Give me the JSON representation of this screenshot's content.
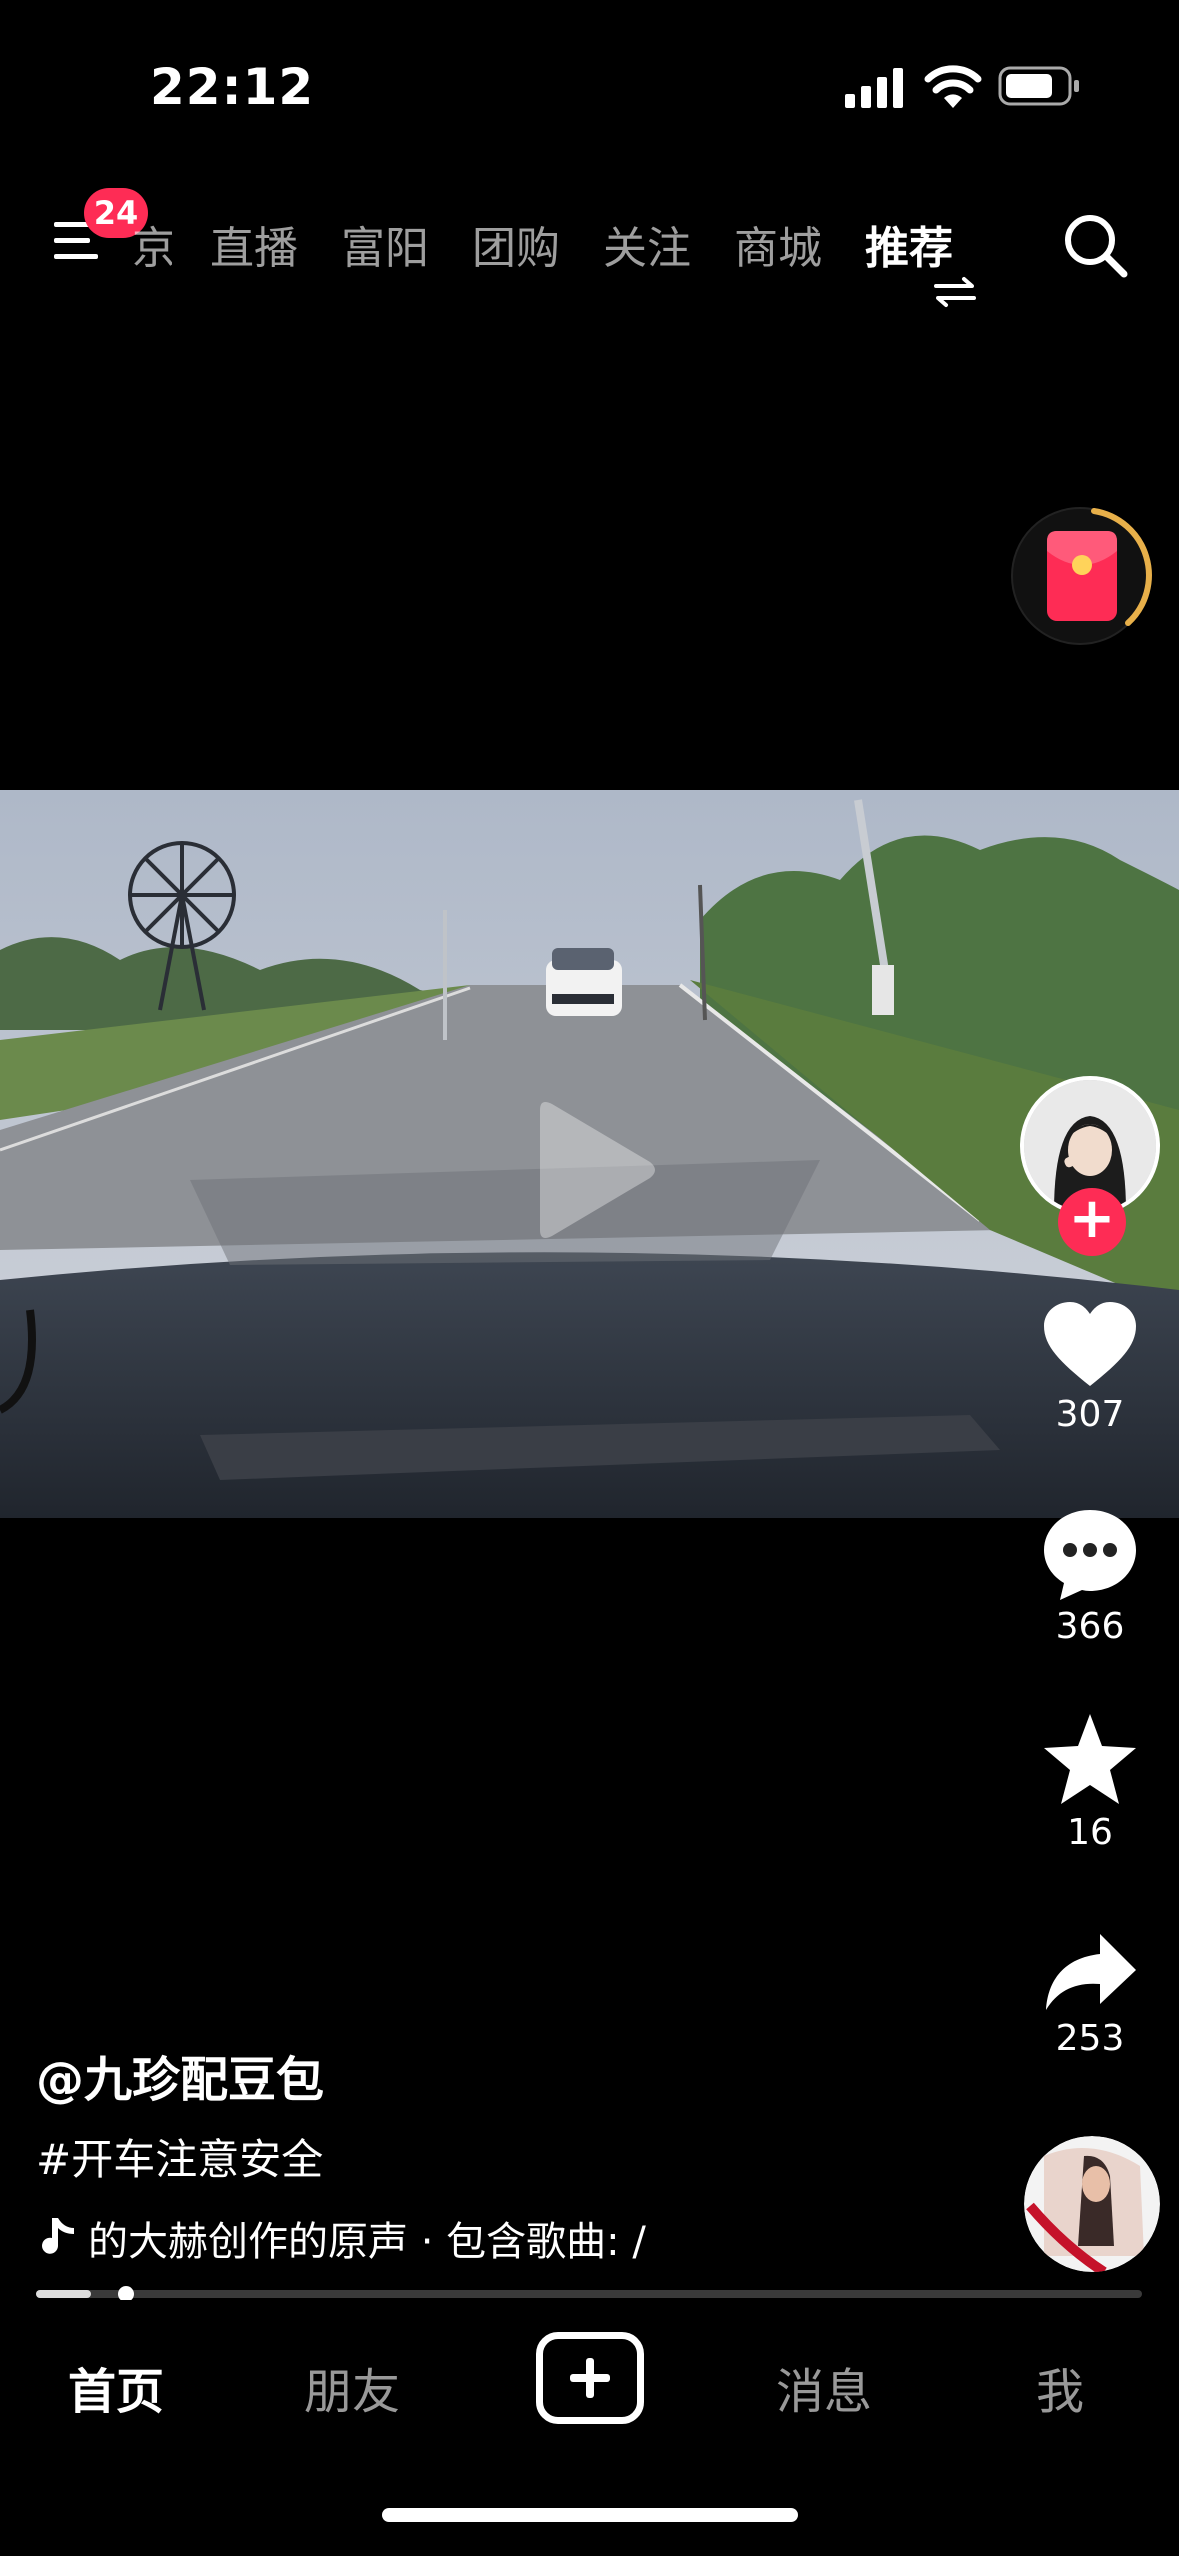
{
  "status_bar": {
    "time": "22:12"
  },
  "top_nav": {
    "badge_count": "24",
    "tabs": [
      {
        "label": "京",
        "state": "partial"
      },
      {
        "label": "直播"
      },
      {
        "label": "富阳"
      },
      {
        "label": "团购"
      },
      {
        "label": "关注"
      },
      {
        "label": "商城"
      },
      {
        "label": "推荐",
        "state": "active"
      }
    ],
    "icons": {
      "menu": "menu-icon",
      "search": "search-icon",
      "swap": "swap-icon"
    }
  },
  "red_packet": {
    "icon": "red-packet-icon",
    "accent": "#fe2c55"
  },
  "video": {
    "icon": "play-icon",
    "progress": 0.05
  },
  "actions": {
    "like_count": "307",
    "comment_count": "366",
    "favorite_count": "16",
    "share_count": "253"
  },
  "post": {
    "author": "@九珍配豆包",
    "hashtag": "#开车注意安全",
    "music": "的大赫创作的原声 · 包含歌曲: /"
  },
  "bottom_nav": {
    "home": "首页",
    "friends": "朋友",
    "messages": "消息",
    "me": "我"
  },
  "colors": {
    "accent": "#fe2c55",
    "background": "#000000"
  }
}
